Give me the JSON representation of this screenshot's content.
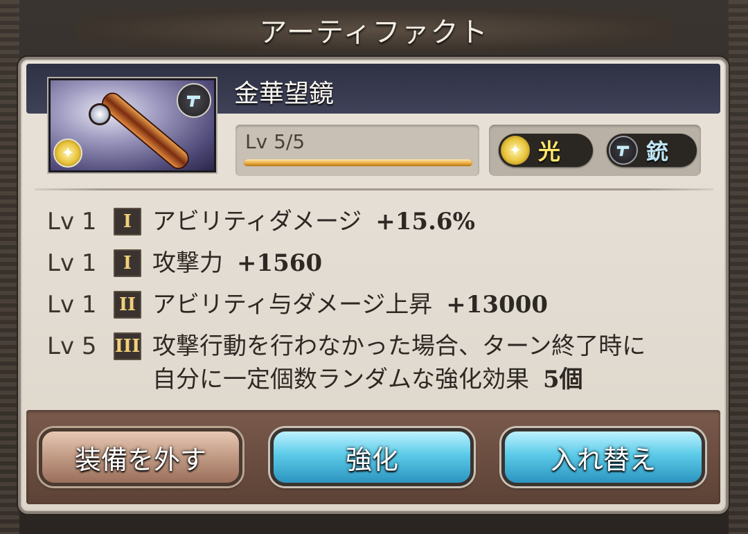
{
  "window": {
    "title": "アーティファクト"
  },
  "item": {
    "name": "金華望鏡",
    "level_text": "Lv 5/5",
    "level_progress": 1.0,
    "thumbnail_element_icon": "light-element-icon",
    "thumbnail_weapon_icon": "gun-icon"
  },
  "attributes": [
    {
      "icon": "light-element-icon",
      "label": "光",
      "color": "#ffe66a"
    },
    {
      "icon": "gun-icon",
      "label": "銃",
      "color": "#bfe6f4"
    }
  ],
  "skills": [
    {
      "level": "Lv 1",
      "tier": "I",
      "name": "アビリティダメージ",
      "value": "+15.6%"
    },
    {
      "level": "Lv 1",
      "tier": "I",
      "name": "攻撃力",
      "value": "+1560"
    },
    {
      "level": "Lv 1",
      "tier": "II",
      "name": "アビリティ与ダメージ上昇",
      "value": "+13000"
    },
    {
      "level": "Lv 5",
      "tier": "III",
      "line1": "攻撃行動を行わなかった場合、ターン終了時に",
      "line2_text": "自分に一定個数ランダムな強化効果",
      "value": "5個"
    }
  ],
  "buttons": {
    "remove": "装備を外す",
    "enhance": "強化",
    "swap": "入れ替え"
  },
  "colors": {
    "accent_gold": "#e9a73c",
    "button_blue": "#5ccbe8",
    "header_band": "#3f4258"
  }
}
